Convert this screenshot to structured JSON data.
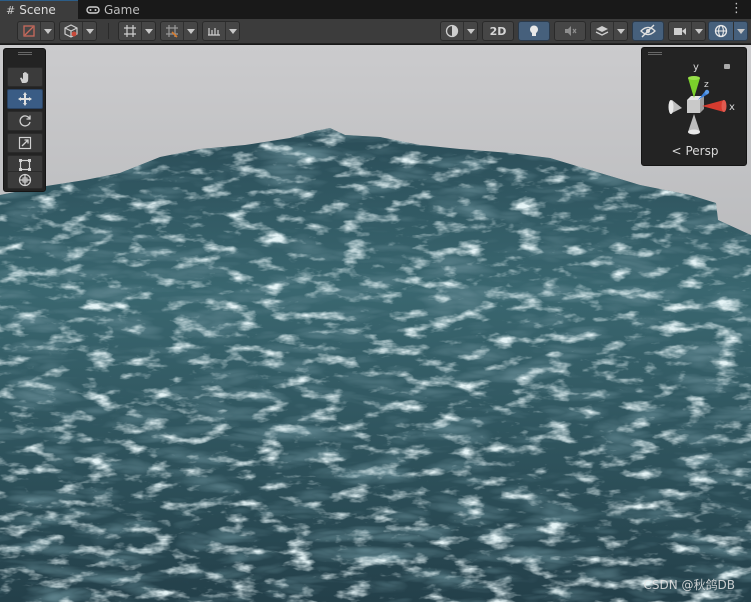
{
  "tabs": [
    {
      "label": "Scene",
      "icon": "hash-icon"
    },
    {
      "label": "Game",
      "icon": "gamepad-icon"
    }
  ],
  "toolbar": {
    "two_d_label": "2D",
    "items": [
      "draw-mode",
      "shading-mode",
      "grid-snapping",
      "increment-snap",
      "visibility",
      "2d",
      "lighting",
      "audio",
      "effects",
      "hidden-objects",
      "camera",
      "gizmos"
    ],
    "lighting_active": true,
    "hidden_active": true
  },
  "tools": [
    "hand-tool",
    "move-tool",
    "rotate-tool",
    "scale-tool",
    "rect-tool",
    "transform-tool"
  ],
  "active_tool": "move-tool",
  "gizmo": {
    "axis_labels": {
      "y": "y",
      "x": "x",
      "z": "z"
    },
    "projection_label": "Persp",
    "colors": {
      "x": "#d63b2f",
      "y": "#7ad02b",
      "z": "#3a7fd8"
    }
  },
  "watermark": "CSDN @秋鸽DB",
  "colors": {
    "accent": "#3a5c85",
    "toolbar_bg": "#3c3c3c",
    "sky_top": "#c8c8ca",
    "sky_bottom": "#9fa2a5",
    "water_dark": "#1f3d47",
    "water_light": "#5e8a90"
  }
}
